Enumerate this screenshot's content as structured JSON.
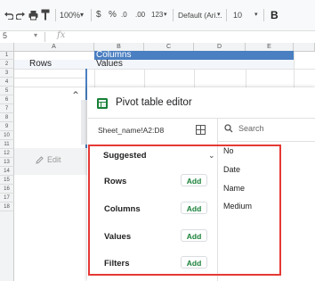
{
  "toolbar": {
    "undo_icon": "undo-icon",
    "redo_icon": "redo-icon",
    "print_icon": "print-icon",
    "paint_icon": "paint-format-icon",
    "zoom": "100%",
    "currency": "$",
    "percent": "%",
    "dec_decrease": ".0",
    "dec_increase": ".00",
    "more_formats": "123",
    "font": "Default (Ari...",
    "font_size": "10",
    "bold": "B"
  },
  "formula_bar": {
    "cell_ref": "5",
    "fx": "fx"
  },
  "columns": [
    "A",
    "B",
    "C",
    "D",
    "E"
  ],
  "rows": [
    "1",
    "2",
    "3",
    "4",
    "5",
    "6",
    "7",
    "8",
    "9",
    "10",
    "11",
    "12",
    "13",
    "14",
    "15",
    "16",
    "17",
    "18"
  ],
  "cells": {
    "b1": "Columns",
    "a2": "Rows",
    "b2": "Values"
  },
  "edit_button": "Edit",
  "pivot": {
    "title": "Pivot table editor",
    "range": "Sheet_name!A2:D8",
    "search_placeholder": "Search",
    "suggested": "Suggested",
    "sections": [
      {
        "label": "Rows",
        "add": "Add"
      },
      {
        "label": "Columns",
        "add": "Add"
      },
      {
        "label": "Values",
        "add": "Add"
      },
      {
        "label": "Filters",
        "add": "Add"
      }
    ],
    "fields": [
      "No",
      "Date",
      "Name",
      "Medium"
    ]
  },
  "colors": {
    "accent_green": "#188038",
    "highlight_red": "#e53935",
    "header_blue": "#4a7fc1"
  }
}
